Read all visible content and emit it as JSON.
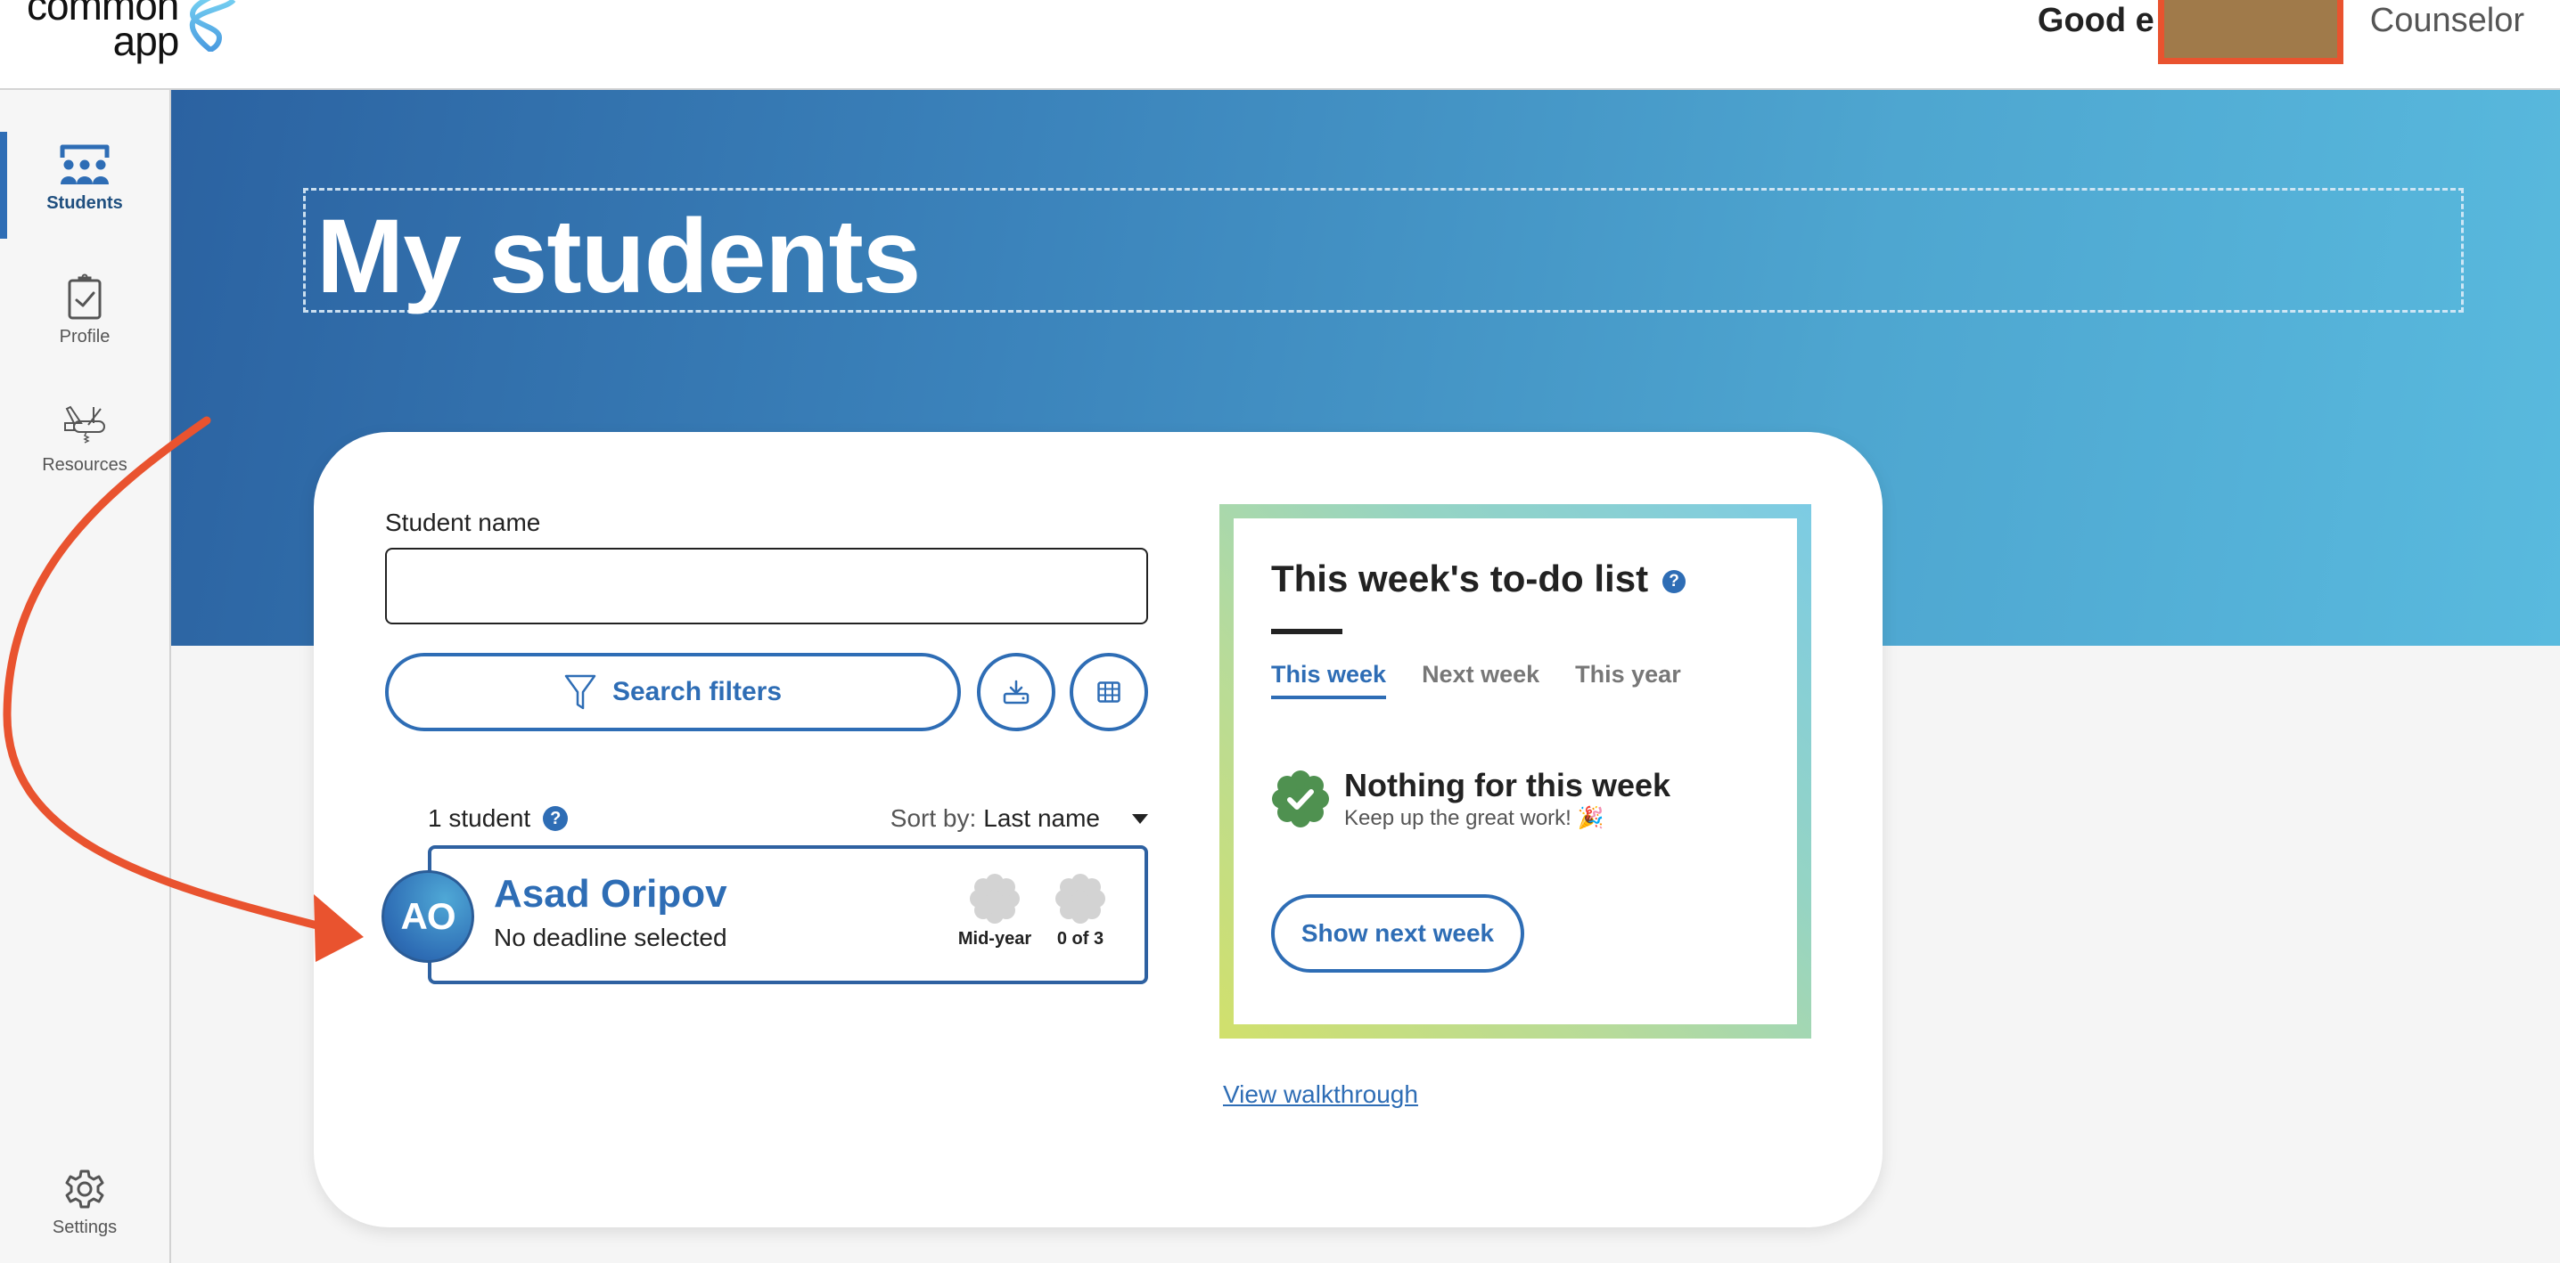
{
  "header": {
    "logo_line1": "common",
    "logo_line2": "app",
    "greeting": "Good e",
    "role": "Counselor"
  },
  "sidebar": {
    "items": [
      {
        "label": "Students",
        "icon": "students-icon",
        "active": true
      },
      {
        "label": "Profile",
        "icon": "clipboard-check-icon",
        "active": false
      },
      {
        "label": "Resources",
        "icon": "swiss-army-knife-icon",
        "active": false
      },
      {
        "label": "Settings",
        "icon": "gear-icon",
        "active": false
      }
    ]
  },
  "banner": {
    "title": "My students"
  },
  "search": {
    "label": "Student name",
    "value": "",
    "placeholder": "",
    "filters_label": "Search filters",
    "download_icon": "download-icon",
    "grid_icon": "grid-view-icon"
  },
  "results": {
    "count_label": "1 student",
    "help": "?",
    "sort_prefix": "Sort by:",
    "sort_value": "Last name",
    "students": [
      {
        "initials": "AO",
        "name": "Asad Oripov",
        "deadline": "No deadline selected",
        "badges": [
          {
            "label": "Mid-year"
          },
          {
            "label": "0 of 3"
          }
        ]
      }
    ]
  },
  "todo": {
    "title": "This week's to-do list",
    "help": "?",
    "tabs": [
      {
        "label": "This week",
        "active": true
      },
      {
        "label": "Next week",
        "active": false
      },
      {
        "label": "This year",
        "active": false
      }
    ],
    "empty_title": "Nothing for this week",
    "empty_sub": "Keep up the great work! 🎉",
    "next_button": "Show next week"
  },
  "walkthrough_link": "View walkthrough",
  "colors": {
    "accent": "#2e6db5",
    "annotation": "#e9532f",
    "success": "#4f9150"
  }
}
